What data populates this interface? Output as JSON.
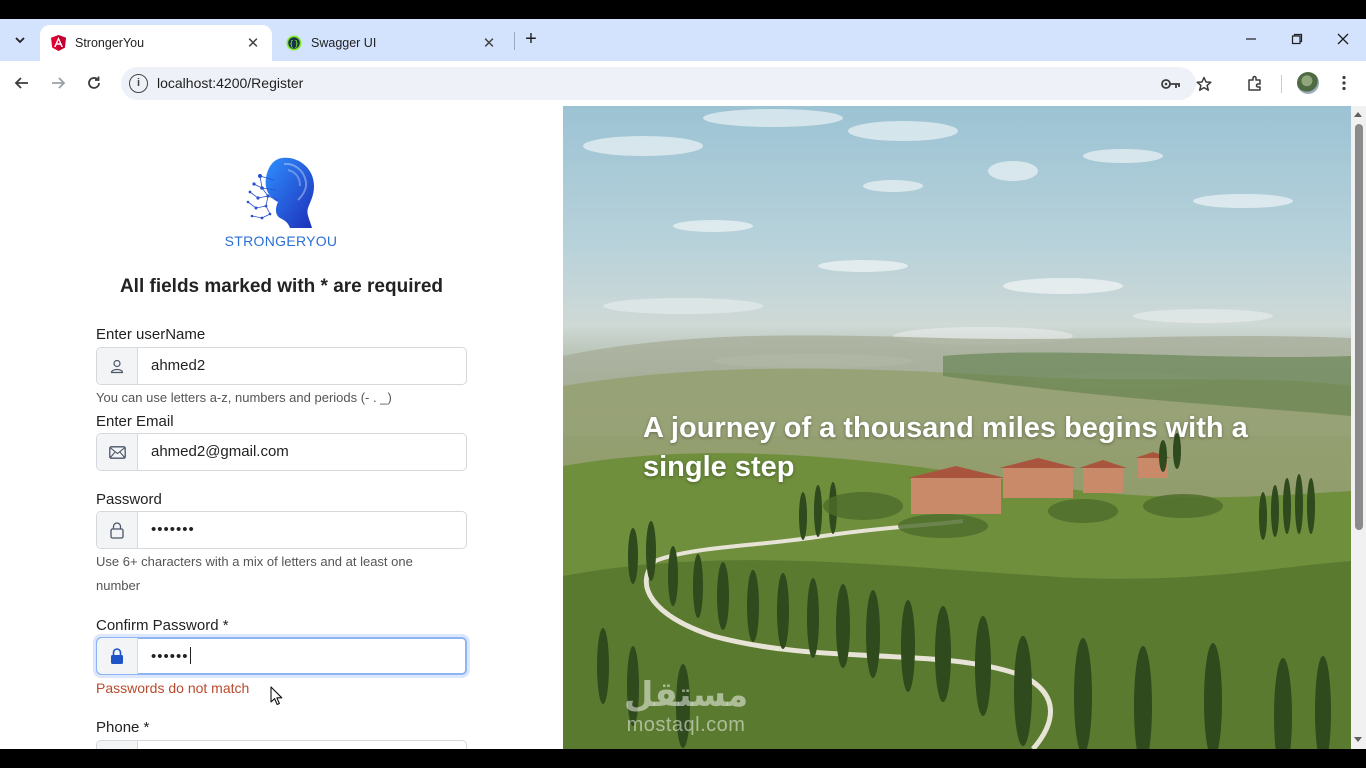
{
  "browser": {
    "tabs": [
      {
        "title": "StrongerYou",
        "active": true
      },
      {
        "title": "Swagger UI",
        "active": false
      }
    ],
    "new_tab": "+",
    "url": "localhost:4200/Register"
  },
  "app": {
    "logo_text": "STRONGERYOU",
    "heading": "All fields marked with * are required"
  },
  "form": {
    "username": {
      "label": "Enter userName",
      "value": "ahmed2",
      "hint": "You can use letters a-z, numbers and periods (- . _)"
    },
    "email": {
      "label": "Enter Email",
      "value": "ahmed2@gmail.com"
    },
    "password": {
      "label": "Password",
      "value": "•••••••",
      "hint": "Use 6+ characters with a mix of letters and at least one number"
    },
    "confirm_password": {
      "label": "Confirm Password *",
      "value": "••••••",
      "error": "Passwords do not match"
    },
    "phone": {
      "label": "Phone *"
    }
  },
  "hero": {
    "quote": "A journey of a thousand miles begins with a single step"
  },
  "watermark": {
    "arabic": "مستقل",
    "latin": "mostaql.com"
  },
  "colors": {
    "brand_blue": "#2a6fd6",
    "error_red": "#b94a2c",
    "focus_ring": "#8db4f3"
  }
}
